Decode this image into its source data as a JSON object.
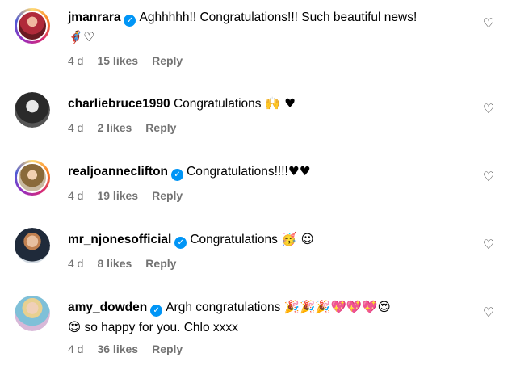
{
  "comments": [
    {
      "username": "jmanrara",
      "verified": true,
      "text": "Aghhhhh!! Congratulations!!! Such beautiful news!",
      "emoji_line": "🦸♡",
      "time": "4 d",
      "likes": "15 likes",
      "reply": "Reply"
    },
    {
      "username": "charliebruce1990",
      "verified": false,
      "text": "Congratulations",
      "emojis": "🙌 ♥",
      "time": "4 d",
      "likes": "2 likes",
      "reply": "Reply"
    },
    {
      "username": "realjoanneclifton",
      "verified": true,
      "text": "Congratulations!!!!",
      "emojis": "♥♥",
      "time": "4 d",
      "likes": "19 likes",
      "reply": "Reply"
    },
    {
      "username": "mr_njonesofficial",
      "verified": true,
      "text": "Congratulations",
      "emojis": "🥳 ☺",
      "time": "4 d",
      "likes": "8 likes",
      "reply": "Reply"
    },
    {
      "username": "amy_dowden",
      "verified": true,
      "text": "Argh congratulations",
      "emojis": "🎉🎉🎉💖💖💖😍",
      "text2_emoji": "😍",
      "text2": "so happy for you. Chlo xxxx",
      "time": "4 d",
      "likes": "36 likes",
      "reply": "Reply"
    }
  ],
  "icons": {
    "like": "heart-outline-icon",
    "verified": "verified-badge-icon"
  }
}
